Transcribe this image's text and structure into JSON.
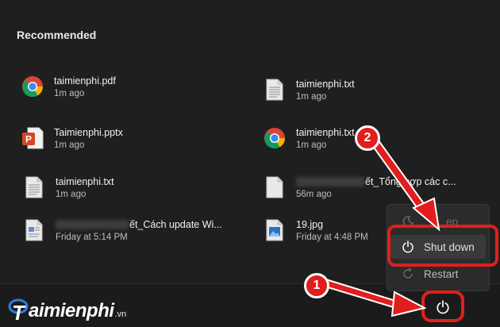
{
  "section": {
    "title": "Recommended"
  },
  "recommended": [
    {
      "name": "taimienphi.pdf",
      "time": "1m ago",
      "icon": "chrome-icon"
    },
    {
      "name": "taimienphi.txt",
      "time": "1m ago",
      "icon": "text-file-icon"
    },
    {
      "name": "Taimienphi.pptx",
      "time": "1m ago",
      "icon": "powerpoint-icon"
    },
    {
      "name": "taimienphi.txt",
      "time": "1m ago",
      "icon": "chrome-icon"
    },
    {
      "name": "taimienphi.txt",
      "time": "1m ago",
      "icon": "text-file-icon"
    },
    {
      "name": "ết_Tổng hợp các c...",
      "time": "56m ago",
      "icon": "blank-file-icon"
    },
    {
      "name": "ết_Cách update Wi...",
      "time": "Friday at 5:14 PM",
      "icon": "document-icon"
    },
    {
      "name": "19.jpg",
      "time": "Friday at 4:48 PM",
      "icon": "image-file-icon"
    }
  ],
  "power_menu": {
    "sleep_label": "ep",
    "shutdown_label": "Shut down",
    "restart_label": "Restart"
  },
  "annotations": {
    "step1": "1",
    "step2": "2"
  },
  "logo": {
    "text": "aimienphi",
    "suffix": ".vn"
  },
  "colors": {
    "accent_red": "#e0201c",
    "background": "#1f1f1f",
    "menu": "#2b2b2b"
  }
}
